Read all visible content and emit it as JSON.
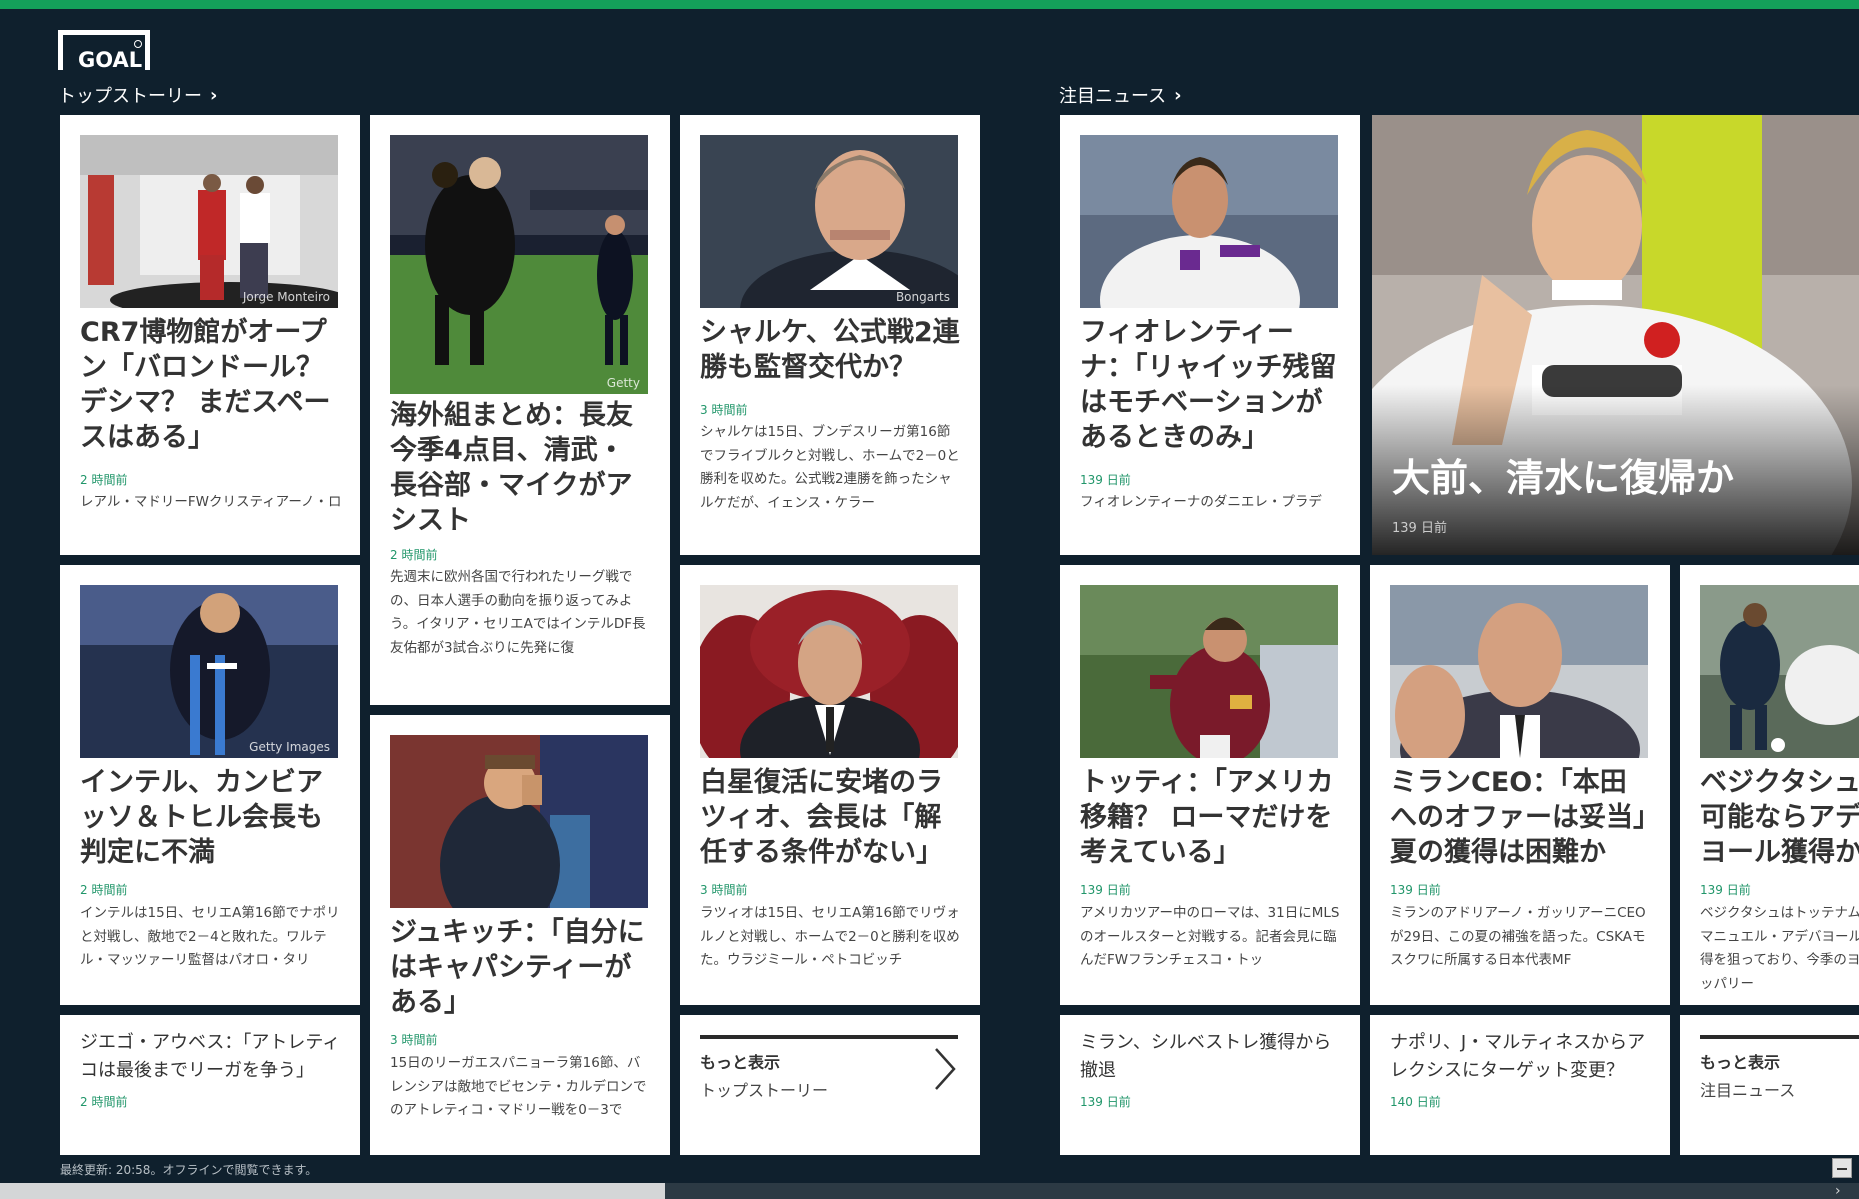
{
  "app": {
    "logo_text": "GOAL"
  },
  "sections": {
    "top_stories": "トップストーリー",
    "featured_news": "注目ニュース"
  },
  "cards": [
    {
      "title": "CR7博物館がオープン「バロンドール？デシマ？ まだスペースはある」",
      "time": "2 時間前",
      "summary": "レアル・マドリーFWクリスティアーノ・ロ",
      "credit": "Jorge Monteiro"
    },
    {
      "title": "海外組まとめ：長友今季4点目、清武・長谷部・マイクがアシスト",
      "time": "2 時間前",
      "summary": "先週末に欧州各国で行われたリーグ戦での、日本人選手の動向を振り返ってみよう。イタリア・セリエAではインテルDF長友佑都が3試合ぶりに先発に復",
      "credit": "Getty"
    },
    {
      "title": "シャルケ、公式戦2連勝も監督交代か？",
      "time": "3 時間前",
      "summary": "シャルケは15日、ブンデスリーガ第16節でフライブルクと対戦し、ホームで2－0と勝利を収めた。公式戦2連勝を飾ったシャルケだが、イェンス・ケラー",
      "credit": "Bongarts"
    },
    {
      "title": "インテル、カンビアッソ＆トヒル会長も判定に不満",
      "time": "2 時間前",
      "summary": "インテルは15日、セリエA第16節でナポリと対戦し、敵地で2－4と敗れた。ワルテル・マッツァーリ監督はパオロ・タリ",
      "credit": "Getty Images"
    },
    {
      "title": "ジュキッチ：「自分にはキャパシティーがある」",
      "time": "3 時間前",
      "summary": "15日のリーガエスパニョーラ第16節、バレンシアは敵地でビセンテ・カルデロンでのアトレティコ・マドリー戦を0－3で"
    },
    {
      "title": "白星復活に安堵のラツィオ、会長は「解任する条件がない」",
      "time": "3 時間前",
      "summary": "ラツィオは15日、セリエA第16節でリヴォルノと対戦し、ホームで2－0と勝利を収めた。ウラジミール・ペトコビッチ"
    },
    {
      "title": "フィオレンティーナ：「リャイッチ残留はモチベーションがあるときのみ」",
      "time": "139 日前",
      "summary": "フィオレンティーナのダニエレ・プラデ"
    },
    {
      "title": "トッティ：「アメリカ移籍？ ローマだけを考えている」",
      "time": "139 日前",
      "summary": "アメリカツアー中のローマは、31日にMLSのオールスターと対戦する。記者会見に臨んだFWフランチェスコ・トッ"
    },
    {
      "title": "ミランCEO：「本田へのオファーは妥当」夏の獲得は困難か",
      "time": "139 日前",
      "summary": "ミランのアドリアーノ・ガッリアーニCEOが29日、この夏の補強を語った。CSKAモスクワに所属する日本代表MF"
    },
    {
      "title": "ベジクタシュ、可能ならアデバヨール獲得か",
      "time": "139 日前",
      "summary": "ベジクタシュはトッテナムのエマニュエル・アデバヨールの獲得を狙っており、今季のヨーロッパリー"
    }
  ],
  "hero": {
    "title": "大前、清水に復帰か",
    "time": "139 日前"
  },
  "small_cards": [
    {
      "title": "ジエゴ・アウベス：「アトレティコは最後までリーガを争う」",
      "time": "2 時間前"
    },
    {
      "title": "ミラン、シルベストレ獲得から撤退",
      "time": "139 日前"
    },
    {
      "title": "ナポリ、J・マルティネスからアレクシスにターゲット変更？",
      "time": "140 日前"
    }
  ],
  "more": [
    {
      "label": "もっと表示",
      "section": "トップストーリー"
    },
    {
      "label": "もっと表示",
      "section": "注目ニュース"
    }
  ],
  "footer": {
    "status": "最終更新: 20:58。オフラインで閲覧できます。"
  },
  "colors": {
    "accent": "#14a05a",
    "background": "#0f202d",
    "time_green": "#21966a"
  }
}
